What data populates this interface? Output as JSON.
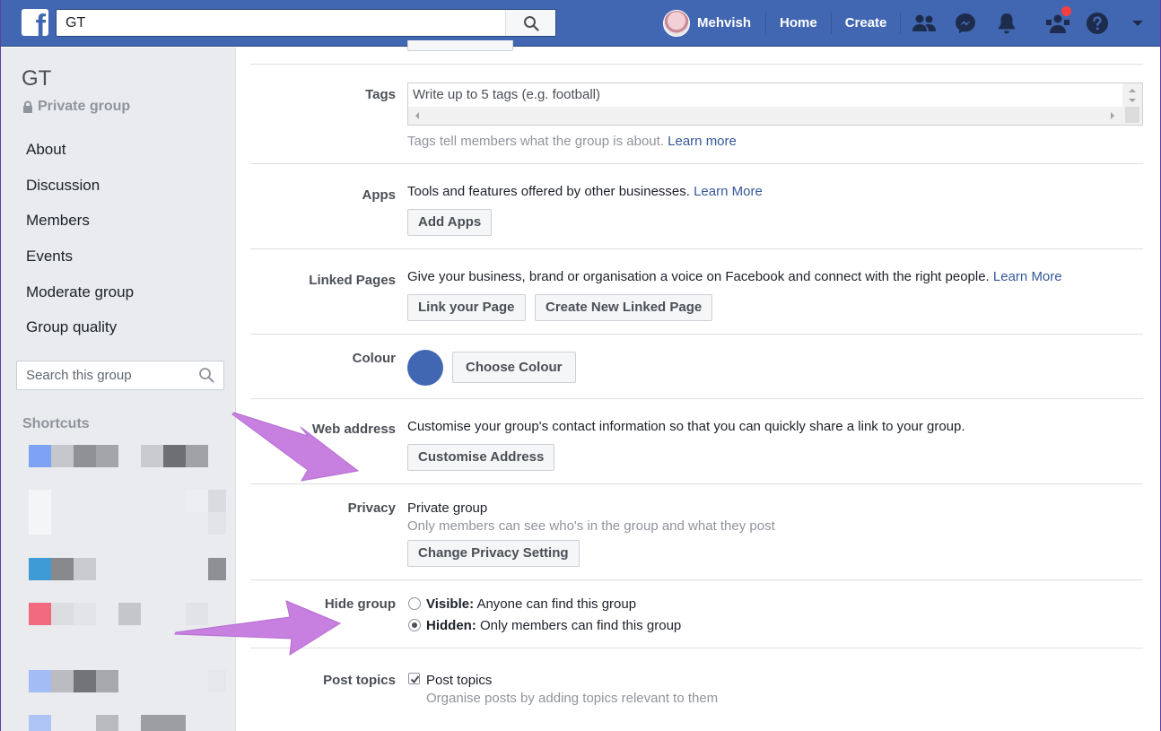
{
  "topbar": {
    "logo_letter": "f",
    "search_value": "GT",
    "user_name": "Mehvish",
    "home_label": "Home",
    "create_label": "Create",
    "icons": [
      "friends-icon",
      "messenger-icon",
      "notifications-bell-icon",
      "group-admin-icon",
      "help-icon",
      "account-menu-chevron-icon"
    ],
    "brand_color": "#4267b2"
  },
  "sidebar": {
    "group_name": "GT",
    "privacy_label": "Private group",
    "menu": [
      {
        "label": "About"
      },
      {
        "label": "Discussion"
      },
      {
        "label": "Members"
      },
      {
        "label": "Events"
      },
      {
        "label": "Moderate group"
      },
      {
        "label": "Group quality"
      }
    ],
    "search_placeholder": "Search this group",
    "shortcuts_label": "Shortcuts"
  },
  "settings": {
    "tags": {
      "label": "Tags",
      "placeholder": "Write up to 5 tags (e.g. football)",
      "help": "Tags tell members what the group is about.",
      "help_link": "Learn more"
    },
    "apps": {
      "label": "Apps",
      "description": "Tools and features offered by other businesses.",
      "link": "Learn More",
      "button": "Add Apps"
    },
    "linked_pages": {
      "label": "Linked Pages",
      "description": "Give your business, brand or organisation a voice on Facebook and connect with the right people.",
      "link": "Learn More",
      "button_link": "Link your Page",
      "button_create": "Create New Linked Page"
    },
    "colour": {
      "label": "Colour",
      "button": "Choose Colour",
      "swatch_color": "#4267b2"
    },
    "web_address": {
      "label": "Web address",
      "description": "Customise your group's contact information so that you can quickly share a link to your group.",
      "button": "Customise Address"
    },
    "privacy": {
      "label": "Privacy",
      "value": "Private group",
      "description": "Only members can see who's in the group and what they post",
      "button": "Change Privacy Setting"
    },
    "hide_group": {
      "label": "Hide group",
      "options": [
        {
          "title": "Visible:",
          "text": "Anyone can find this group",
          "selected": false
        },
        {
          "title": "Hidden:",
          "text": "Only members can find this group",
          "selected": true
        }
      ]
    },
    "post_topics": {
      "label": "Post topics",
      "checkbox_label": "Post topics",
      "checked": true,
      "description": "Organise posts by adding topics relevant to them"
    }
  },
  "annotations": {
    "arrow_color": "#c77fe0"
  }
}
